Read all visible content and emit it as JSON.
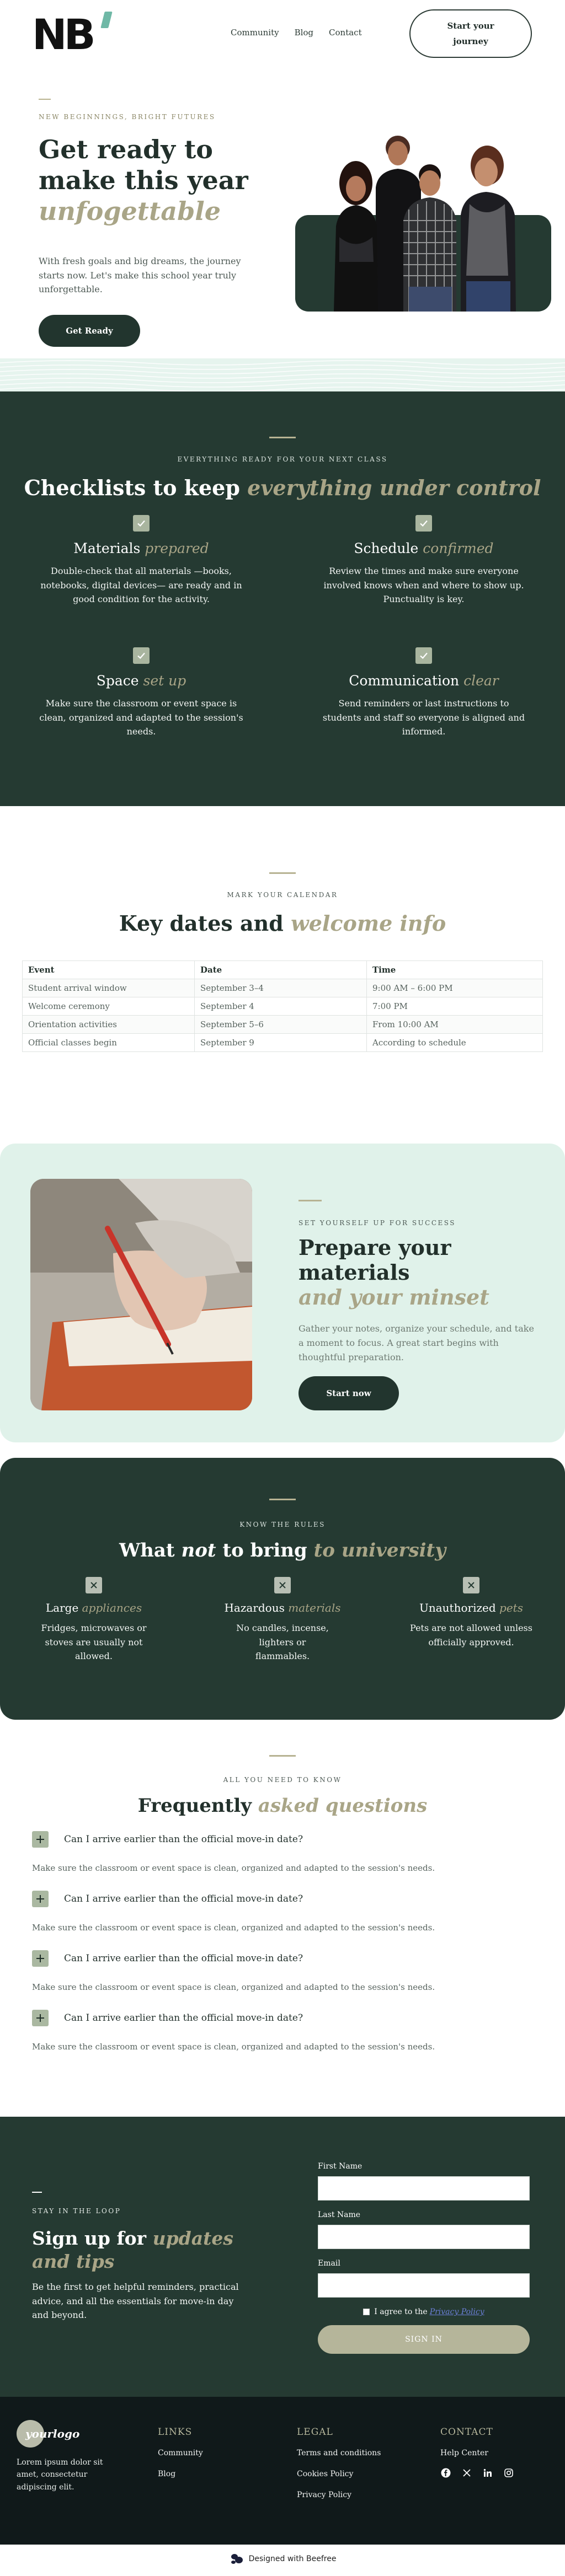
{
  "header": {
    "logo": "NB",
    "nav": [
      "Community",
      "Blog",
      "Contact"
    ],
    "cta": "Start your journey"
  },
  "hero": {
    "eyebrow": "NEW BEGINNINGS, BRIGHT FUTURES",
    "title_plain": "Get ready to make this year",
    "title_accent": "unfogettable",
    "text": "With fresh goals and big dreams, the journey starts now. Let's make this school year truly unforgettable.",
    "button": "Get Ready"
  },
  "checklist": {
    "eyebrow": "EVERYTHING READY FOR YOUR NEXT CLASS",
    "title_plain": "Checklists to keep",
    "title_accent": "everything under control",
    "items": [
      {
        "title": "Materials",
        "accent": "prepared",
        "text": "Double-check that all materials —books, notebooks, digital devices— are ready and in good condition for the activity."
      },
      {
        "title": "Schedule",
        "accent": "confirmed",
        "text": "Review the times and make sure everyone involved knows when and where to show up. Punctuality is key."
      },
      {
        "title": "Space",
        "accent": "set up",
        "text": "Make sure the classroom or event space is clean, organized and adapted to the session's needs."
      },
      {
        "title": "Communication",
        "accent": "clear",
        "text": "Send reminders or last instructions to students and staff so everyone is aligned and informed."
      }
    ]
  },
  "dates": {
    "eyebrow": "MARK YOUR CALENDAR",
    "title_plain": "Key dates and",
    "title_accent": "welcome info",
    "headers": [
      "Event",
      "Date",
      "Time"
    ],
    "rows": [
      [
        "Student arrival window",
        "September 3–4",
        "9:00 AM – 6:00 PM"
      ],
      [
        "Welcome ceremony",
        "September 4",
        "7:00 PM"
      ],
      [
        "Orientation activities",
        "September 5–6",
        "From 10:00 AM"
      ],
      [
        "Official classes begin",
        "September 9",
        "According to schedule"
      ]
    ]
  },
  "materials": {
    "eyebrow": "SET YOURSELF UP FOR SUCCESS",
    "title_plain": "Prepare your materials",
    "title_accent": "and your minset",
    "text": "Gather your notes, organize your schedule, and take a moment to focus. A great start begins with thoughtful preparation.",
    "button": "Start now"
  },
  "rules": {
    "eyebrow": "KNOW THE RULES",
    "title_a": "What",
    "title_b": "not",
    "title_c": "to bring",
    "title_accent": "to university",
    "items": [
      {
        "title": "Large",
        "accent": "appliances",
        "text": "Fridges, microwaves or stoves are usually not allowed."
      },
      {
        "title": "Hazardous",
        "accent": "materials",
        "text": "No candles, incense, lighters or flammables."
      },
      {
        "title": "Unauthorized",
        "accent": "pets",
        "text": "Pets are not allowed unless officially approved."
      }
    ]
  },
  "faq": {
    "eyebrow": "ALL YOU NEED TO KNOW",
    "title_plain": "Frequently",
    "title_accent": "asked questions",
    "items": [
      {
        "q": "Can I arrive earlier than the official move-in date?",
        "a": "Make sure the classroom or event space is clean, organized and adapted to the session's needs."
      },
      {
        "q": "Can I arrive earlier than the official move-in date?",
        "a": "Make sure the classroom or event space is clean, organized and adapted to the session's needs."
      },
      {
        "q": "Can I arrive earlier than the official move-in date?",
        "a": "Make sure the classroom or event space is clean, organized and adapted to the session's needs."
      },
      {
        "q": "Can I arrive earlier than the official move-in date?",
        "a": "Make sure the classroom or event space is clean, organized and adapted to the session's needs."
      }
    ]
  },
  "newsletter": {
    "eyebrow": "STAY IN THE LOOP",
    "title_plain": "Sign up for",
    "title_accent": "updates and tips",
    "text": "Be the first to get helpful reminders, practical advice, and all the essentials for move-in day and beyond.",
    "first_name": "First Name",
    "last_name": "Last Name",
    "email": "Email",
    "agree": "I agree to the",
    "policy": "Privacy Policy",
    "button": "SIGN IN"
  },
  "footer": {
    "logo": "yourlogo",
    "about": "Lorem ipsum dolor sit amet, consectetur adipiscing elit.",
    "links_title": "LINKS",
    "links": [
      "Community",
      "Blog"
    ],
    "legal_title": "LEGAL",
    "legal": [
      "Terms and conditions",
      "Cookies Policy",
      "Privacy Policy"
    ],
    "contact_title": "CONTACT",
    "contact": [
      "Help Center"
    ],
    "social_icons": [
      "facebook-icon",
      "x-icon",
      "linkedin-icon",
      "instagram-icon"
    ],
    "designed": "Designed with Beefree"
  },
  "colors": {
    "dark_green": "#253a32",
    "accent": "#a9a587",
    "mint": "#e0f2ea",
    "check": "#a9b59f"
  }
}
